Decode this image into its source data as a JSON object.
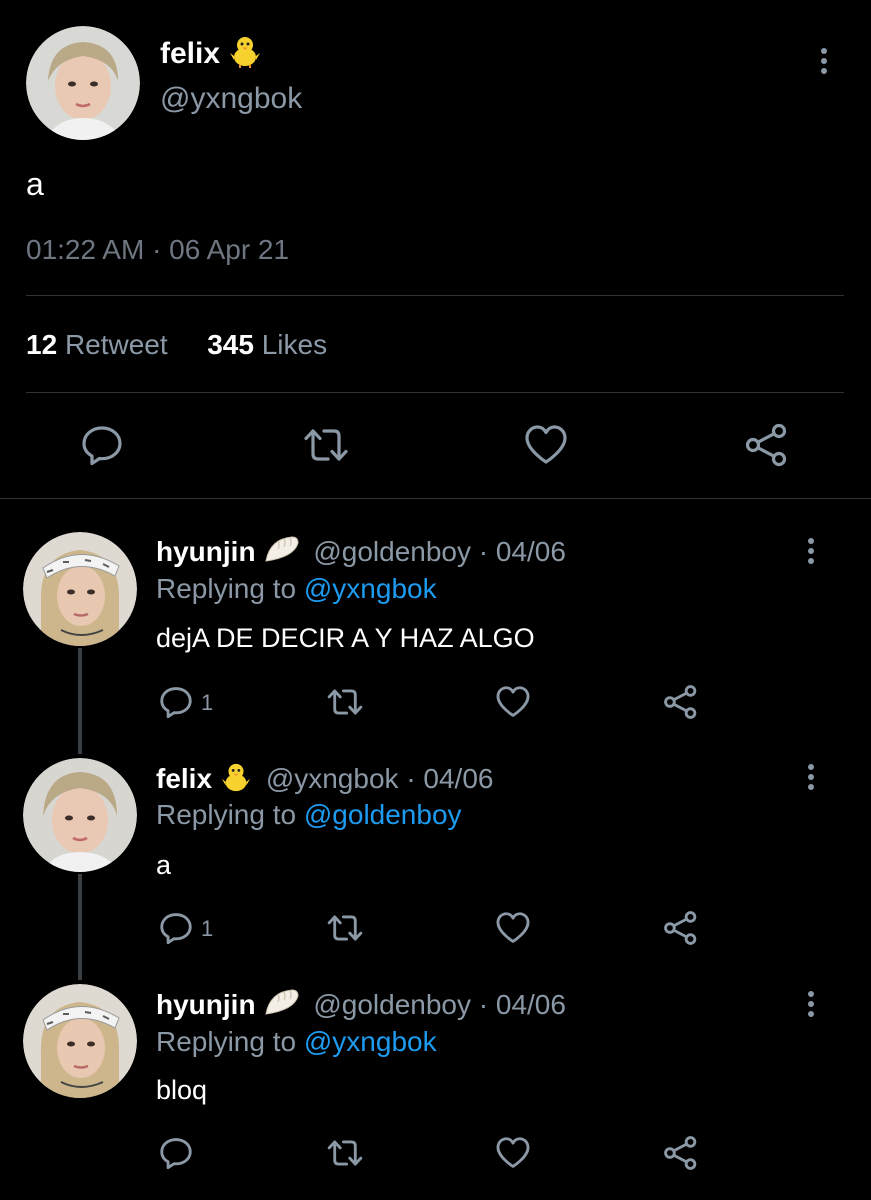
{
  "main_tweet": {
    "name": "felix",
    "emoji": "🐥",
    "handle": "@yxngbok",
    "text": "a",
    "timestamp": "01:22 AM · 06 Apr 21",
    "retweet_count": "12",
    "retweet_label": "Retweet",
    "likes_count": "345",
    "likes_label": "Likes"
  },
  "replies": [
    {
      "name": "hyunjin",
      "emoji": "🥟",
      "handle": "@goldenboy",
      "date": "· 04/06",
      "replying_label": "Replying to",
      "replying_to": "@yxngbok",
      "text": "dejA DE DECIR A Y HAZ ALGO",
      "reply_count": "1"
    },
    {
      "name": "felix",
      "emoji": "🐥",
      "handle": "@yxngbok",
      "date": "· 04/06",
      "replying_label": "Replying to",
      "replying_to": "@goldenboy",
      "text": "a",
      "reply_count": "1"
    },
    {
      "name": "hyunjin",
      "emoji": "🥟",
      "handle": "@goldenboy",
      "date": "· 04/06",
      "replying_label": "Replying to",
      "replying_to": "@yxngbok",
      "text": "bloq",
      "reply_count": ""
    }
  ],
  "icons": {
    "reply": "reply-icon",
    "retweet": "retweet-icon",
    "like": "heart-icon",
    "share": "share-icon",
    "more": "more-icon"
  },
  "colors": {
    "background": "#000000",
    "secondary_text": "#8b98a5",
    "link": "#1d9bf0",
    "divider": "#2f3336"
  }
}
